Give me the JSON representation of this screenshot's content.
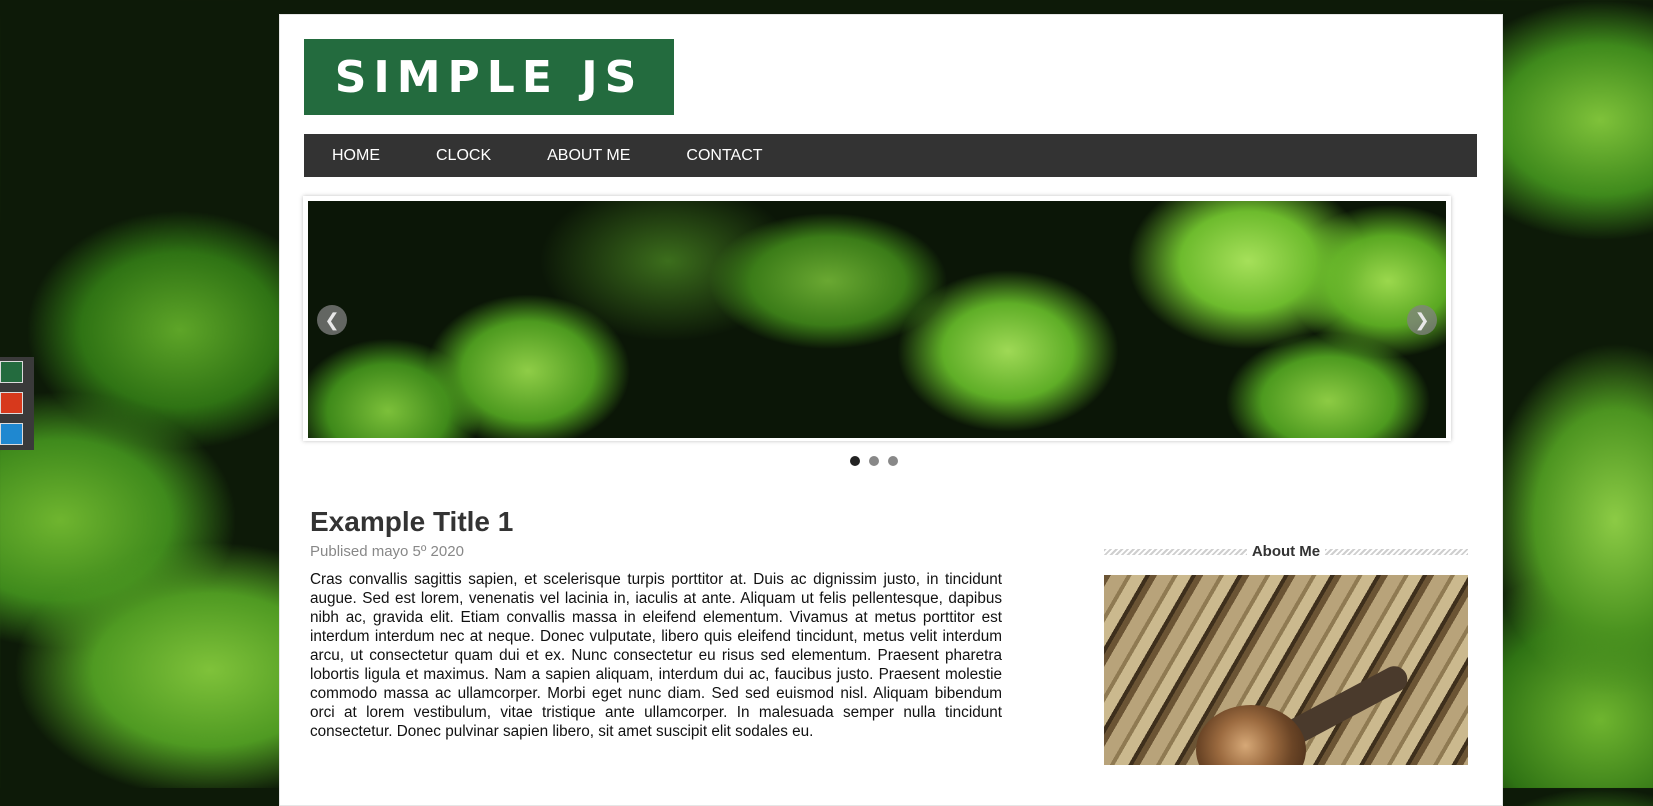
{
  "header": {
    "logo_text": "SIMPLE JS"
  },
  "nav": {
    "items": [
      {
        "label": "HOME"
      },
      {
        "label": "CLOCK"
      },
      {
        "label": "ABOUT ME"
      },
      {
        "label": "CONTACT"
      }
    ]
  },
  "slider": {
    "prev_icon": "chevron-left-icon",
    "next_icon": "chevron-right-icon",
    "prev_glyph": "❮",
    "next_glyph": "❯",
    "dot_count": 3,
    "active_dot": 1
  },
  "post": {
    "title": "Example Title 1",
    "date": "Publised mayo 5º 2020",
    "body": "Cras convallis sagittis sapien, et scelerisque turpis porttitor at. Duis ac dignissim justo, in tincidunt augue. Sed est lorem, venenatis vel lacinia in, iaculis at ante. Aliquam ut felis pellentesque, dapibus nibh ac, gravida elit. Etiam convallis massa in eleifend elementum. Vivamus at metus porttitor est interdum interdum nec at neque. Donec vulputate, libero quis eleifend tincidunt, metus velit interdum arcu, ut consectetur quam dui et ex. Nunc consectetur eu risus sed elementum. Praesent pharetra lobortis ligula et maximus. Nam a sapien aliquam, interdum dui ac, faucibus justo. Praesent molestie commodo massa ac ullamcorper. Morbi eget nunc diam. Sed sed euismod nisl. Aliquam bibendum orci at lorem vestibulum, vitae tristique ante ullamcorper. In malesuada semper nulla tincidunt consectetur. Donec pulvinar sapien libero, sit amet suscipit elit sodales eu."
  },
  "sidebar": {
    "widget_title": "About Me"
  },
  "theme_switcher": {
    "colors": [
      "#236b3e",
      "#d7391c",
      "#1f88d0"
    ]
  },
  "colors": {
    "brand_green": "#236b3e",
    "nav_bg": "#333333"
  }
}
